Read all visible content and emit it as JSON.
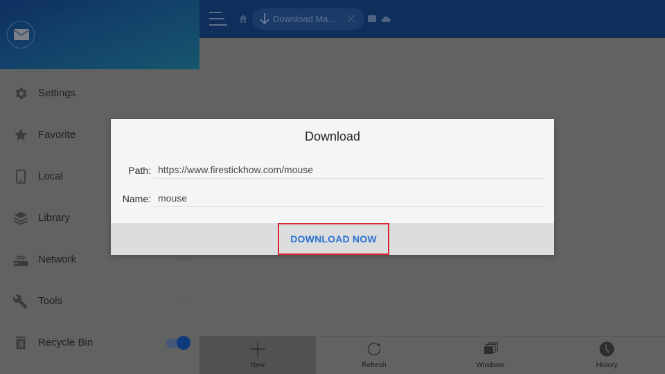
{
  "topbar": {
    "tab": {
      "label": "Download Ma..."
    }
  },
  "sidebar": {
    "items": [
      {
        "label": "Settings",
        "icon": "gear-icon"
      },
      {
        "label": "Favorite",
        "icon": "star-icon"
      },
      {
        "label": "Local",
        "icon": "phone-icon"
      },
      {
        "label": "Library",
        "icon": "layers-icon"
      },
      {
        "label": "Network",
        "icon": "router-icon",
        "expandable": true
      },
      {
        "label": "Tools",
        "icon": "wrench-icon",
        "expandable": true
      },
      {
        "label": "Recycle Bin",
        "icon": "trash-icon",
        "toggle": true
      }
    ]
  },
  "bottombar": {
    "items": [
      {
        "label": "New",
        "icon": "plus-icon",
        "active": true
      },
      {
        "label": "Refresh",
        "icon": "refresh-icon"
      },
      {
        "label": "Windows",
        "icon": "windows-icon"
      },
      {
        "label": "History",
        "icon": "clock-icon"
      }
    ]
  },
  "dialog": {
    "title": "Download",
    "path_label": "Path:",
    "path_value": "https://www.firestickhow.com/mouse",
    "name_label": "Name:",
    "name_value": "mouse",
    "download_button": "DOWNLOAD NOW"
  },
  "colors": {
    "accent": "#2a72cf",
    "highlight_border": "#d9262f",
    "header": "#0f2e5c",
    "toggle_on": "#0f3a7c"
  }
}
